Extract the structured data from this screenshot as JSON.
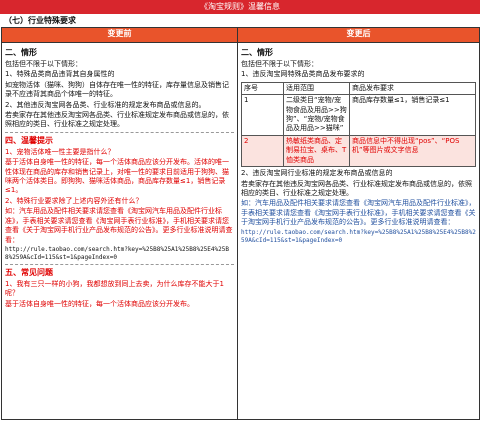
{
  "banner": "《淘宝规则》温馨信息",
  "section_title": "（七）行业特殊要求",
  "headers": {
    "before": "变更前",
    "after": "变更后"
  },
  "left": {
    "s2_title": "二、情形",
    "p1": "包括但不限于以下情形：",
    "p2": "1、特殊品类商品违背其自身属性的",
    "p3": "如宠物活体（猫咪、狗狗）自体存在唯一性的特征，库存量信息及销售记录不应违背其商品个体唯一的特征。",
    "p4": "2、其他违反淘宝网各品类、行业标准的规定发布商品或信息的。",
    "p5": "若卖家存在其他违反淘宝网各品类、行业标准规定发布商品或信息的，依照相应的类目、行业标准之规定处理。",
    "s4_title": "四、温馨提示",
    "q1": "1、宠物活体唯一性主要是指什么？",
    "a1": "基于活体自身唯一性的特征，每一个活体商品应该分开发布。活体的唯一性体现在商品的库存和销售记录上，对唯一性的要求目前适用于狗狗、猫咪两个活体类目。即狗狗、猫咪活体商品，商品库存数量≤1，销售记录≤1。",
    "q2": "2、特殊行业要求除了上述内容外还有什么？",
    "a2": "如：汽车用品及配件相关要求请您查看《淘宝网汽车用品及配件行业标准》，手表相关要求请您查看《淘宝网手表行业标准》，手机相关要求请您查看《关于淘宝网手机行业产品发布规范的公告》。更多行业标准说明请查看：",
    "url": "http://rule.taobao.com/search.htm?key=%25B8%25A1%25B8%25E4%25B8%259A&cId=115&st=1&pageIndex=0",
    "s5_title": "五、常见问题",
    "q3": "1、我有三只一样的小狗，我都想放到同上去卖，为什么库存不能大于1呢？",
    "a3": "基于活体自身唯一性的特征，每一个活体商品应该分开发布。"
  },
  "right": {
    "s2_title": "二、情形",
    "p1": "包括但不限于以下情形：",
    "p2": "1、违反淘宝网特殊品类商品发布要求的",
    "table_headers": [
      "序号",
      "适用范围",
      "商品发布要求"
    ],
    "rows": [
      {
        "no": "1",
        "scope": "二级类目“宠物/宠物食品及用品>>狗狗”、“宠物/宠物食品及用品>>猫咪”",
        "req": "商品库存数量≤1，销售记录≤1"
      },
      {
        "no": "2",
        "scope": "热敏纸类商品、定制易拉宝、桌布、T恤类商品",
        "req": "商品信息中不得出现“pos”、“POS机”等图片或文字信息"
      }
    ],
    "p3": "2、违反淘宝网行业标准的规定发布商品或信息的",
    "p4": "若卖家存在其他违反淘宝网各品类、行业标准规定发布商品或信息的，依照相应的类目、行业标准之规定处理。",
    "p5": "如：汽车用品及配件相关要求请您查看《淘宝网汽车用品及配件行业标准》，手表相关要求请您查看《淘宝网手表行业标准》，手机相关要求请您查看《关于淘宝网手机行业产品发布规范的公告》。更多行业标准说明请查看：",
    "url": "http://rule.taobao.com/search.htm?key=%25B8%25A1%25B8%25E4%25B8%259A&cId=115&st=1&pageIndex=0"
  }
}
